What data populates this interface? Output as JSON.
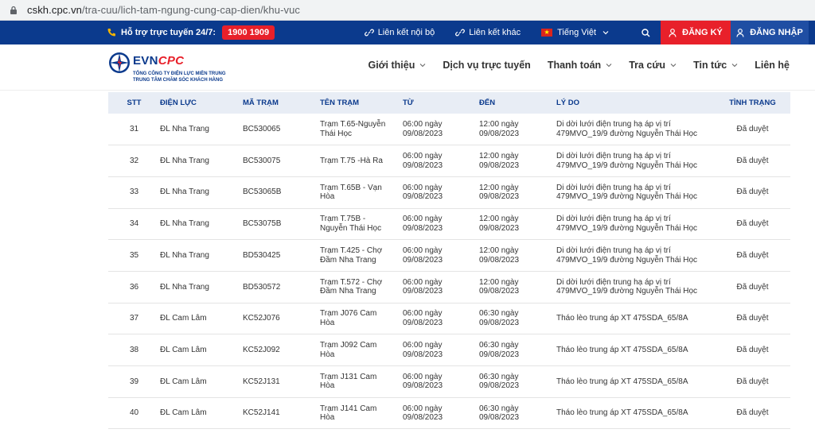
{
  "browser": {
    "url_host": "cskh.cpc.vn",
    "url_path": "/tra-cuu/lich-tam-ngung-cung-cap-dien/khu-vuc"
  },
  "topbar": {
    "support_label": "Hỗ trợ trực tuyến 24/7:",
    "hotline": "1900 1909",
    "internal_link": "Liên kết nội bộ",
    "external_link": "Liên kết khác",
    "language": "Tiếng Việt",
    "register": "ĐĂNG KÝ",
    "login": "ĐĂNG NHẬP"
  },
  "logo": {
    "brand_evn": "EVN",
    "brand_cpc": "CPC",
    "line1": "TỔNG CÔNG TY ĐIỆN LỰC MIỀN TRUNG",
    "line2": "TRUNG TÂM CHĂM SÓC KHÁCH HÀNG"
  },
  "nav": [
    {
      "label": "Giới thiệu",
      "dropdown": true
    },
    {
      "label": "Dịch vụ trực tuyến",
      "dropdown": false
    },
    {
      "label": "Thanh toán",
      "dropdown": true
    },
    {
      "label": "Tra cứu",
      "dropdown": true
    },
    {
      "label": "Tin tức",
      "dropdown": true
    },
    {
      "label": "Liên hệ",
      "dropdown": false
    }
  ],
  "table": {
    "headers": [
      "STT",
      "ĐIỆN LỰC",
      "MÃ TRẠM",
      "TÊN TRẠM",
      "TỪ",
      "ĐẾN",
      "LÝ DO",
      "TÌNH TRẠNG"
    ],
    "rows": [
      {
        "stt": "31",
        "dien_luc": "ĐL Nha Trang",
        "ma_tram": "BC530065",
        "ten_tram_1": "Trạm T.65-Nguyễn",
        "ten_tram_2": "Thái Học",
        "tu_1": "06:00 ngày",
        "tu_2": "09/08/2023",
        "den_1": "12:00 ngày",
        "den_2": "09/08/2023",
        "ly_do_1": "Di dời lưới điện trung hạ áp vị trí",
        "ly_do_2": "479MVO_19/9 đường Nguyễn Thái Học",
        "tinh_trang": "Đã duyệt"
      },
      {
        "stt": "32",
        "dien_luc": "ĐL Nha Trang",
        "ma_tram": "BC530075",
        "ten_tram_1": "Trạm T.75 -Hà Ra",
        "ten_tram_2": "",
        "tu_1": "06:00 ngày",
        "tu_2": "09/08/2023",
        "den_1": "12:00 ngày",
        "den_2": "09/08/2023",
        "ly_do_1": "Di dời lưới điện trung hạ áp vị trí",
        "ly_do_2": "479MVO_19/9 đường Nguyễn Thái Học",
        "tinh_trang": "Đã duyệt"
      },
      {
        "stt": "33",
        "dien_luc": "ĐL Nha Trang",
        "ma_tram": "BC53065B",
        "ten_tram_1": "Trạm T.65B - Vạn",
        "ten_tram_2": "Hòa",
        "tu_1": "06:00 ngày",
        "tu_2": "09/08/2023",
        "den_1": "12:00 ngày",
        "den_2": "09/08/2023",
        "ly_do_1": "Di dời lưới điện trung hạ áp vị trí",
        "ly_do_2": "479MVO_19/9 đường Nguyễn Thái Học",
        "tinh_trang": "Đã duyệt"
      },
      {
        "stt": "34",
        "dien_luc": "ĐL Nha Trang",
        "ma_tram": "BC53075B",
        "ten_tram_1": "Trạm T.75B -",
        "ten_tram_2": "Nguyễn Thái Học",
        "tu_1": "06:00 ngày",
        "tu_2": "09/08/2023",
        "den_1": "12:00 ngày",
        "den_2": "09/08/2023",
        "ly_do_1": "Di dời lưới điện trung hạ áp vị trí",
        "ly_do_2": "479MVO_19/9 đường Nguyễn Thái Học",
        "tinh_trang": "Đã duyệt"
      },
      {
        "stt": "35",
        "dien_luc": "ĐL Nha Trang",
        "ma_tram": "BD530425",
        "ten_tram_1": "Trạm T.425 - Chợ",
        "ten_tram_2": "Đầm Nha Trang",
        "tu_1": "06:00 ngày",
        "tu_2": "09/08/2023",
        "den_1": "12:00 ngày",
        "den_2": "09/08/2023",
        "ly_do_1": "Di dời lưới điện trung hạ áp vị trí",
        "ly_do_2": "479MVO_19/9 đường Nguyễn Thái Học",
        "tinh_trang": "Đã duyệt"
      },
      {
        "stt": "36",
        "dien_luc": "ĐL Nha Trang",
        "ma_tram": "BD530572",
        "ten_tram_1": "Trạm T.572 - Chợ",
        "ten_tram_2": "Đầm Nha Trang",
        "tu_1": "06:00 ngày",
        "tu_2": "09/08/2023",
        "den_1": "12:00 ngày",
        "den_2": "09/08/2023",
        "ly_do_1": "Di dời lưới điện trung hạ áp vị trí",
        "ly_do_2": "479MVO_19/9 đường Nguyễn Thái Học",
        "tinh_trang": "Đã duyệt"
      },
      {
        "stt": "37",
        "dien_luc": "ĐL Cam Lâm",
        "ma_tram": "KC52J076",
        "ten_tram_1": "Trạm J076 Cam",
        "ten_tram_2": "Hòa",
        "tu_1": "06:00 ngày",
        "tu_2": "09/08/2023",
        "den_1": "06:30 ngày",
        "den_2": "09/08/2023",
        "ly_do_1": "Tháo lèo trung áp XT 475SDA_65/8A",
        "ly_do_2": "",
        "tinh_trang": "Đã duyệt"
      },
      {
        "stt": "38",
        "dien_luc": "ĐL Cam Lâm",
        "ma_tram": "KC52J092",
        "ten_tram_1": "Trạm J092 Cam",
        "ten_tram_2": "Hòa",
        "tu_1": "06:00 ngày",
        "tu_2": "09/08/2023",
        "den_1": "06:30 ngày",
        "den_2": "09/08/2023",
        "ly_do_1": "Tháo lèo trung áp XT 475SDA_65/8A",
        "ly_do_2": "",
        "tinh_trang": "Đã duyệt"
      },
      {
        "stt": "39",
        "dien_luc": "ĐL Cam Lâm",
        "ma_tram": "KC52J131",
        "ten_tram_1": "Trạm J131 Cam",
        "ten_tram_2": "Hòa",
        "tu_1": "06:00 ngày",
        "tu_2": "09/08/2023",
        "den_1": "06:30 ngày",
        "den_2": "09/08/2023",
        "ly_do_1": "Tháo lèo trung áp XT 475SDA_65/8A",
        "ly_do_2": "",
        "tinh_trang": "Đã duyệt"
      },
      {
        "stt": "40",
        "dien_luc": "ĐL Cam Lâm",
        "ma_tram": "KC52J141",
        "ten_tram_1": "Trạm J141 Cam",
        "ten_tram_2": "Hòa",
        "tu_1": "06:00 ngày",
        "tu_2": "09/08/2023",
        "den_1": "06:30 ngày",
        "den_2": "09/08/2023",
        "ly_do_1": "Tháo lèo trung áp XT 475SDA_65/8A",
        "ly_do_2": "",
        "tinh_trang": "Đã duyệt"
      }
    ]
  },
  "colors": {
    "topbar_bg": "#0b3a8d",
    "accent_red": "#e8202a",
    "login_bg": "#1f4ea3",
    "table_header_bg": "#e8edf5"
  }
}
